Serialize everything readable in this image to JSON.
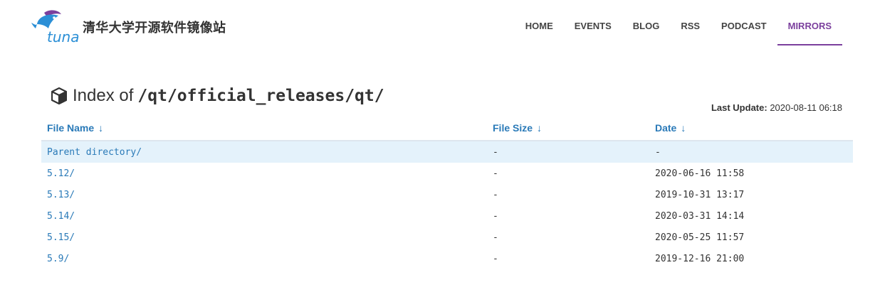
{
  "header": {
    "site_title": "清华大学开源软件镜像站",
    "logo_text": "tuna",
    "nav": [
      {
        "label": "HOME",
        "active": false
      },
      {
        "label": "EVENTS",
        "active": false
      },
      {
        "label": "BLOG",
        "active": false
      },
      {
        "label": "RSS",
        "active": false
      },
      {
        "label": "PODCAST",
        "active": false
      },
      {
        "label": "MIRRORS",
        "active": true
      }
    ]
  },
  "page": {
    "index_label": "Index of",
    "path": "/qt/official_releases/qt/",
    "last_update_label": "Last Update:",
    "last_update_value": "2020-08-11 06:18"
  },
  "table": {
    "columns": [
      {
        "label": "File Name",
        "arrow": "↓"
      },
      {
        "label": "File Size",
        "arrow": "↓"
      },
      {
        "label": "Date",
        "arrow": "↓"
      }
    ],
    "rows": [
      {
        "name": "Parent directory/",
        "size": "-",
        "date": "-"
      },
      {
        "name": "5.12/",
        "size": "-",
        "date": "2020-06-16 11:58"
      },
      {
        "name": "5.13/",
        "size": "-",
        "date": "2019-10-31 13:17"
      },
      {
        "name": "5.14/",
        "size": "-",
        "date": "2020-03-31 14:14"
      },
      {
        "name": "5.15/",
        "size": "-",
        "date": "2020-05-25 11:57"
      },
      {
        "name": "5.9/",
        "size": "-",
        "date": "2019-12-16 21:00"
      }
    ]
  },
  "colors": {
    "accent": "#7b3f9d",
    "link": "#2a7ab8",
    "parent_row_bg": "#e4f2fb",
    "logo_blue": "#2b8fd6"
  }
}
